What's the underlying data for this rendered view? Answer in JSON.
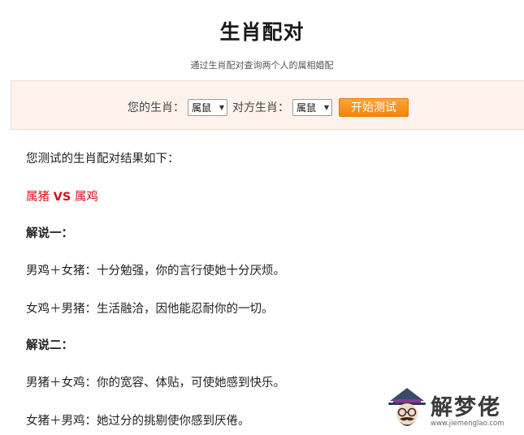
{
  "header": {
    "title": "生肖配对",
    "subtitle": "通过生肖配对查询两个人的属相婚配"
  },
  "form": {
    "your_zodiac_label": "您的生肖：",
    "your_zodiac_value": "属鼠",
    "other_zodiac_label": "对方生肖：",
    "other_zodiac_value": "属鼠",
    "start_button_label": "开始测试"
  },
  "result": {
    "intro": "您测试的生肖配对结果如下：",
    "pair_left": "属猪",
    "pair_vs": "VS",
    "pair_right": "属鸡",
    "section1_title": "解说一：",
    "section1_line1": "男鸡＋女猪：十分勉强，你的言行使她十分厌烦。",
    "section1_line2": "女鸡＋男猪：生活融洽，因他能忍耐你的一切。",
    "section2_title": "解说二：",
    "section2_line1": "男猪＋女鸡：你的宽容、体贴，可使她感到快乐。",
    "section2_line2": "女猪＋男鸡：她过分的挑剔使你感到厌倦。"
  },
  "watermark": {
    "brand": "解梦佬",
    "url": "www.jiemenglao.com",
    "icon": "detective-mascot-icon"
  },
  "colors": {
    "accent_red": "#d4131a",
    "button_orange": "#f5830c",
    "panel_bg": "#fdf3ec"
  }
}
